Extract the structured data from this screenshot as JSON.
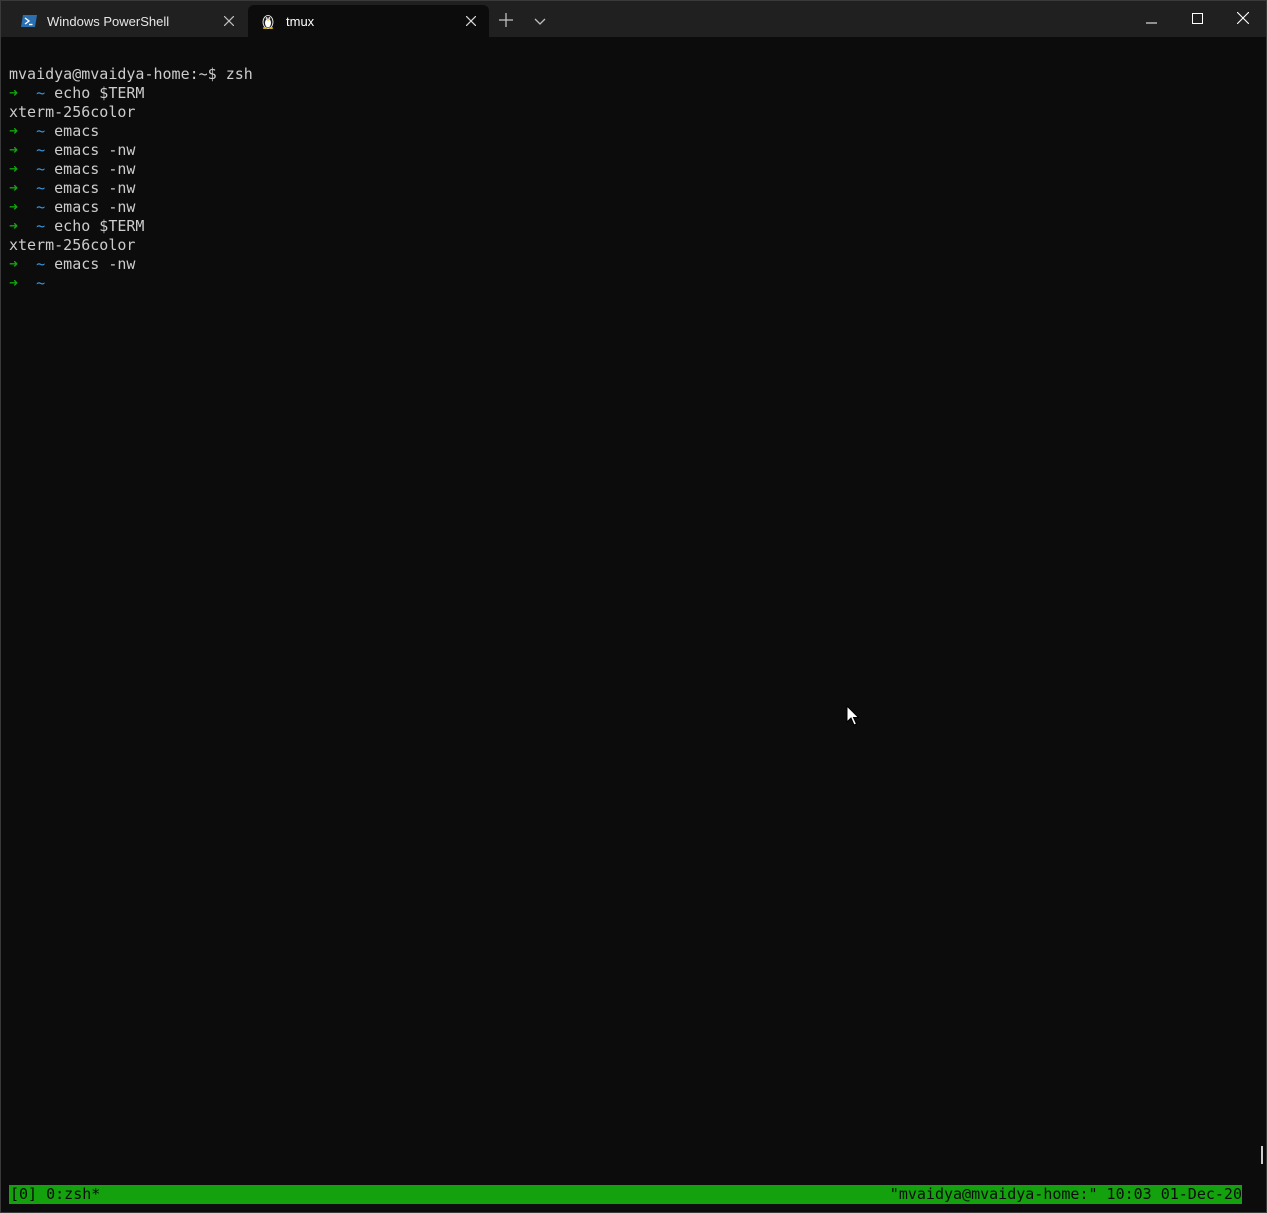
{
  "window": {
    "tabs": [
      {
        "title": "Windows PowerShell",
        "icon": "powershell-icon",
        "active": false
      },
      {
        "title": "tmux",
        "icon": "linux-penguin-icon",
        "active": true
      }
    ],
    "buttons": {
      "new_tab": "plus-icon",
      "dropdown": "chevron-down-icon",
      "minimize": "minimize-icon",
      "maximize": "maximize-icon",
      "close": "close-icon"
    }
  },
  "terminal": {
    "colors": {
      "background": "#0c0c0c",
      "foreground": "#cccccc",
      "prompt_arrow": "#13a10e",
      "prompt_dir": "#3a96dd",
      "status_bg": "#13a10e"
    },
    "lines": [
      {
        "type": "plain",
        "text": "mvaidya@mvaidya-home:~$ zsh"
      },
      {
        "type": "prompt",
        "arrow": "➜",
        "dir": "~",
        "cmd": "echo $TERM"
      },
      {
        "type": "plain",
        "text": "xterm-256color"
      },
      {
        "type": "prompt",
        "arrow": "➜",
        "dir": "~",
        "cmd": "emacs"
      },
      {
        "type": "prompt",
        "arrow": "➜",
        "dir": "~",
        "cmd": "emacs -nw"
      },
      {
        "type": "prompt",
        "arrow": "➜",
        "dir": "~",
        "cmd": "emacs -nw"
      },
      {
        "type": "prompt",
        "arrow": "➜",
        "dir": "~",
        "cmd": "emacs -nw"
      },
      {
        "type": "prompt",
        "arrow": "➜",
        "dir": "~",
        "cmd": "emacs -nw"
      },
      {
        "type": "prompt",
        "arrow": "➜",
        "dir": "~",
        "cmd": "echo $TERM"
      },
      {
        "type": "plain",
        "text": "xterm-256color"
      },
      {
        "type": "prompt",
        "arrow": "➜",
        "dir": "~",
        "cmd": "emacs -nw"
      },
      {
        "type": "prompt",
        "arrow": "➜",
        "dir": "~",
        "cmd": ""
      }
    ],
    "status": {
      "left": "[0] 0:zsh*",
      "right": "\"mvaidya@mvaidya-home:\" 10:03 01-Dec-20"
    }
  }
}
